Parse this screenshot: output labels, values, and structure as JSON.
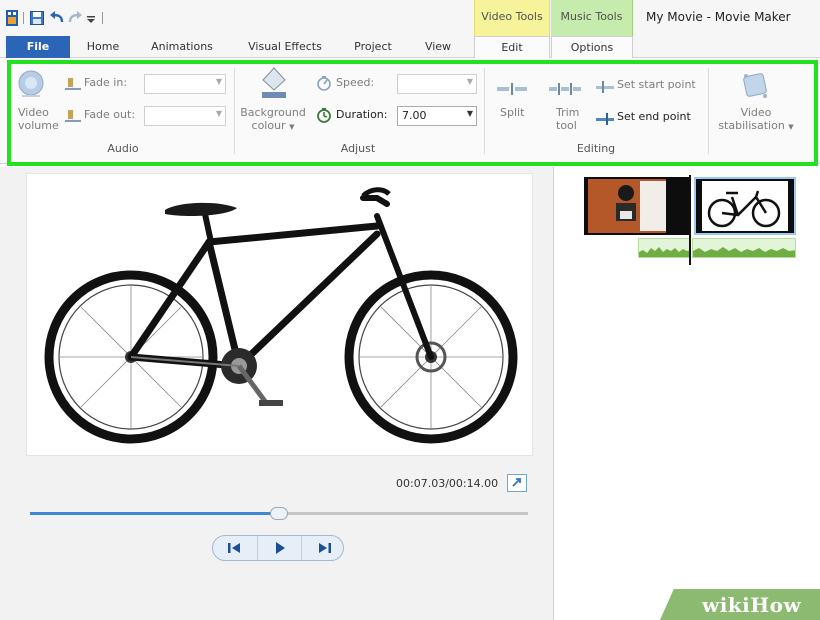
{
  "app": {
    "title": "My Movie - Movie Maker"
  },
  "contextual_tabs": {
    "video_tools": "Video Tools",
    "music_tools": "Music Tools"
  },
  "tabs": [
    "File",
    "Home",
    "Animations",
    "Visual Effects",
    "Project",
    "View",
    "Edit",
    "Options"
  ],
  "ribbon": {
    "audio": {
      "video_volume_label": [
        "Video",
        "volume"
      ],
      "fade_in_label": "Fade in:",
      "fade_out_label": "Fade out:",
      "group_label": "Audio"
    },
    "adjust": {
      "background_colour_label": [
        "Background",
        "colour"
      ],
      "speed_label": "Speed:",
      "duration_label": "Duration:",
      "duration_value": "7.00",
      "group_label": "Adjust"
    },
    "editing": {
      "split_label": "Split",
      "trim_tool_label": [
        "Trim",
        "tool"
      ],
      "set_start_point_label": "Set start point",
      "set_end_point_label": "Set end point",
      "group_label": "Editing"
    },
    "video_stabilisation_label": [
      "Video",
      "stabilisation"
    ]
  },
  "preview": {
    "timecode": "00:07.03/00:14.00",
    "seek_progress": 0.5
  },
  "watermark": {
    "part1": "wiki",
    "part2": "How"
  },
  "colors": {
    "file_tab": "#2c64b8",
    "video_tools_accent": "#f7f39b",
    "music_tools_accent": "#c6ecad",
    "highlight_outline": "#21e121"
  }
}
